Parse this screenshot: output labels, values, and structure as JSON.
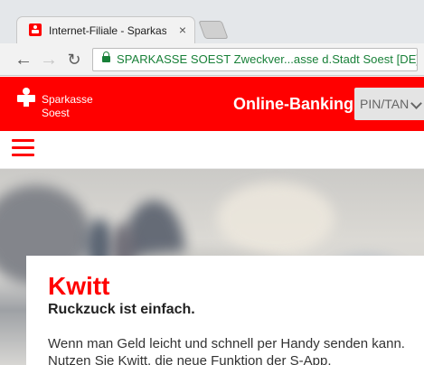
{
  "browser": {
    "tab_title": "Internet-Filiale - Sparkasse",
    "tab_close": "×",
    "nav_back": "←",
    "nav_forward": "→",
    "nav_reload": "↻",
    "site_identity": "SPARKASSE SOEST Zweckver...asse d.Stadt Soest [DE]"
  },
  "bank": {
    "name_line_1": "Sparkasse",
    "name_line_2": "Soest",
    "online_banking": "Online-Banking",
    "auth_select": "PIN/TAN"
  },
  "hero": {
    "title": "Kwitt",
    "subtitle": "Ruckzuck ist einfach.",
    "body_line_1": "Wenn man Geld leicht und schnell per Handy senden kann.",
    "body_line_2": "Nutzen Sie Kwitt, die neue Funktion der S-App."
  },
  "colors": {
    "brand_red": "#ff0000",
    "secure_green": "#188038"
  },
  "icons": {
    "favicon": "sparkasse-s-icon",
    "lock": "lock-icon",
    "menu": "hamburger-menu-icon",
    "select": "chevron-down-icon"
  }
}
